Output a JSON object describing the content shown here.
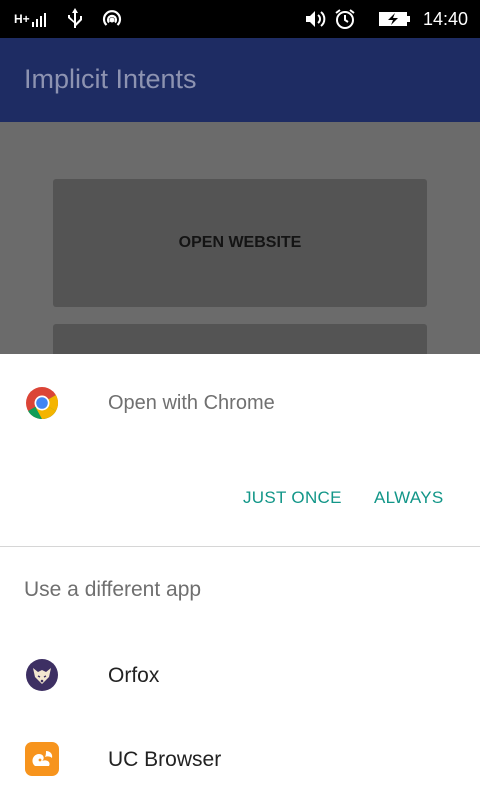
{
  "status_bar": {
    "network_type": "H+",
    "time": "14:40",
    "icons": [
      "signal-icon",
      "usb-icon",
      "hotspot-icon",
      "volume-icon",
      "alarm-icon",
      "battery-charging-icon"
    ]
  },
  "app": {
    "title": "Implicit Intents",
    "open_website_button": "OPEN WEBSITE"
  },
  "chooser": {
    "open_with": "Open with Chrome",
    "just_once_label": "JUST ONCE",
    "always_label": "ALWAYS",
    "different_app_heading": "Use a different app",
    "apps": [
      {
        "label": "Orfox",
        "icon": "orfox-icon"
      },
      {
        "label": "UC Browser",
        "icon": "uc-browser-icon"
      }
    ]
  },
  "colors": {
    "accent": "#129688",
    "app_bar": "#1e2c63"
  }
}
